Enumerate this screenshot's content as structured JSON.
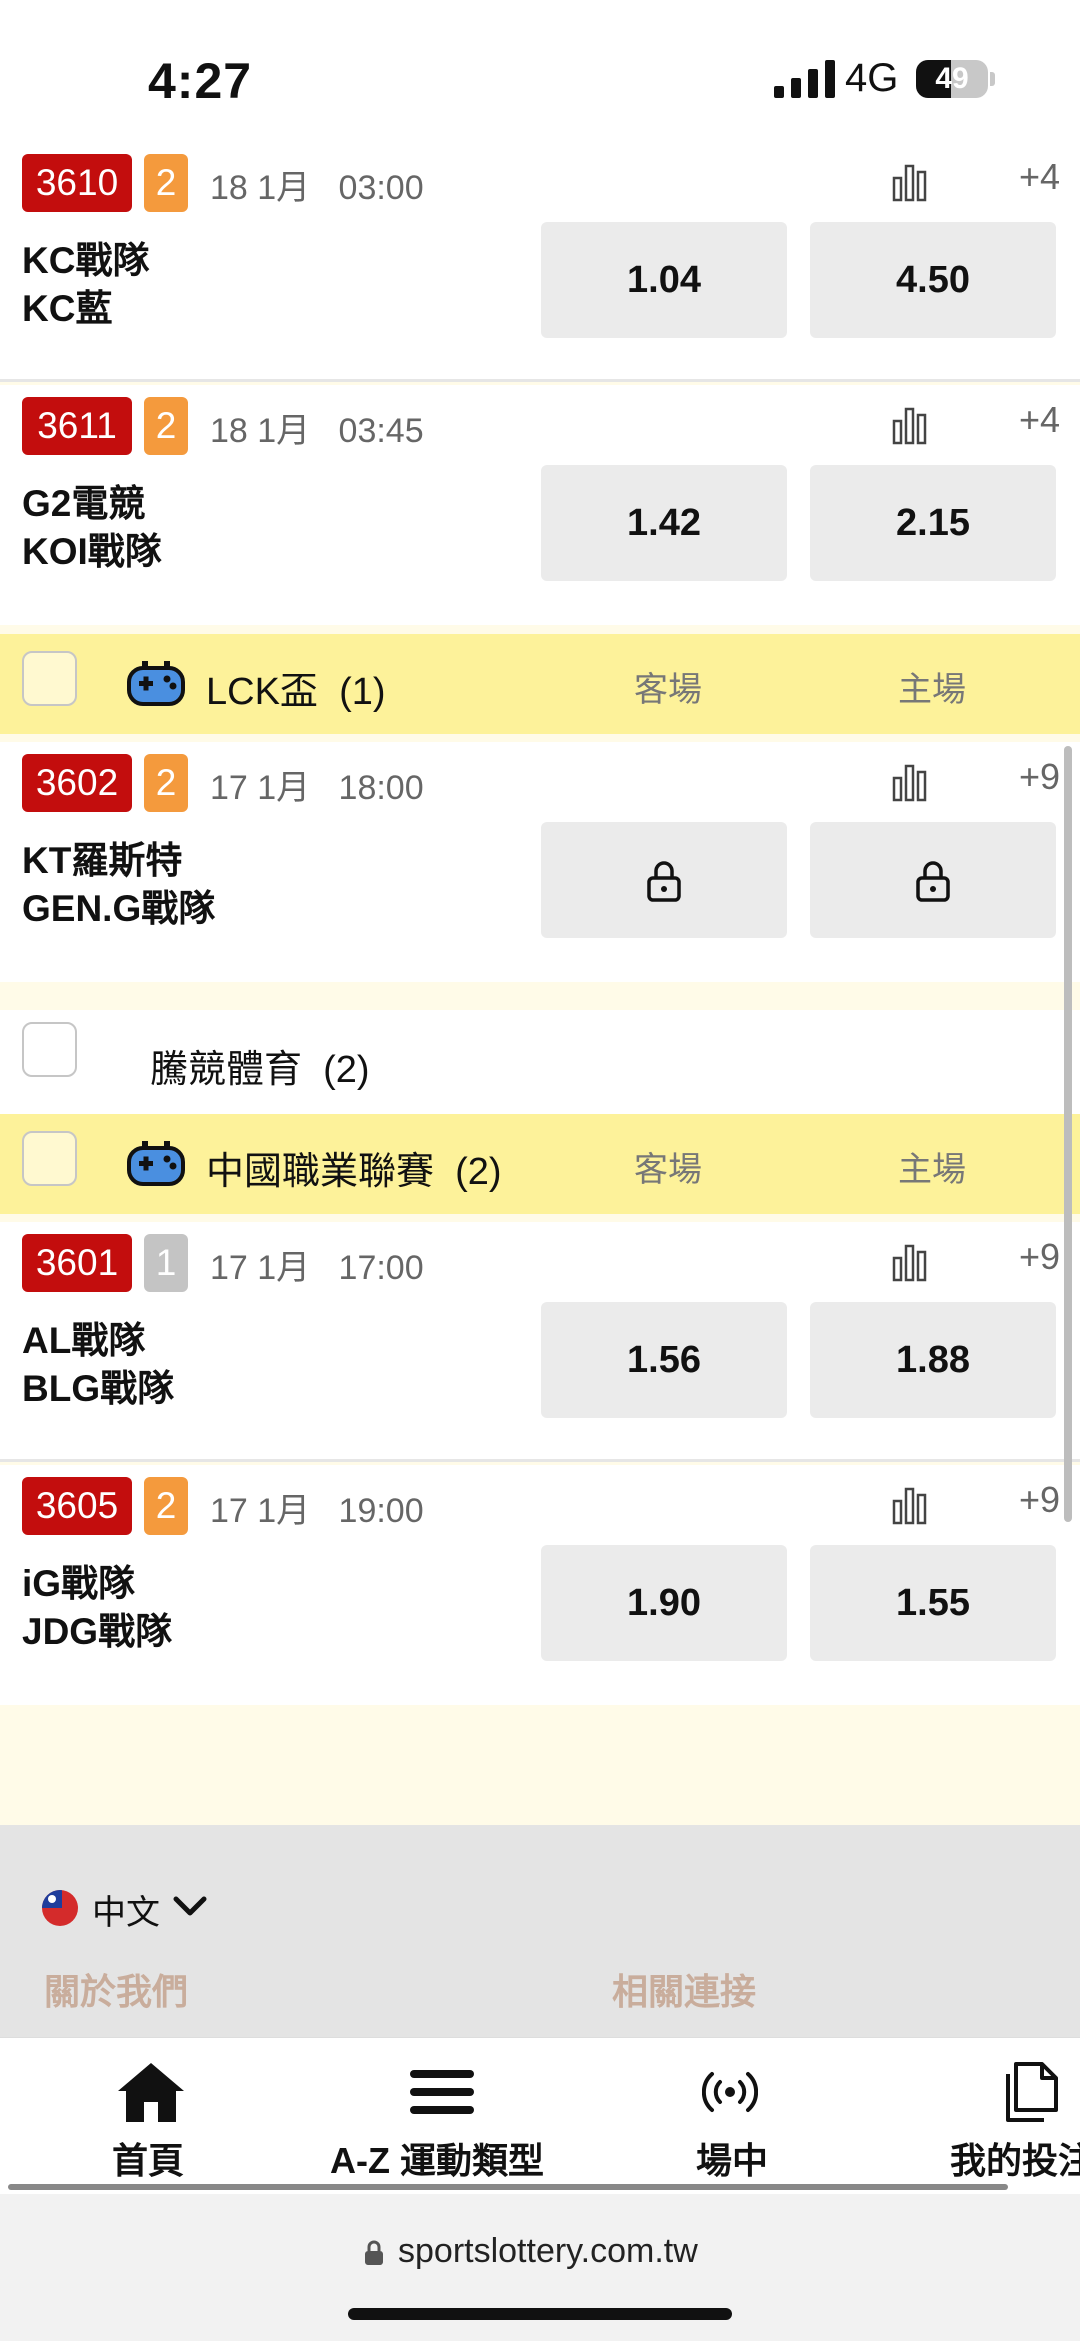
{
  "status_bar": {
    "time": "4:27",
    "network": "4G",
    "battery": "49",
    "battery_level": 0.49
  },
  "matches": [
    {
      "id": "3610",
      "num": "2",
      "date": "18 1月",
      "time": "03:00",
      "more": "+4",
      "team1": "KC戰隊",
      "team2": "KC藍",
      "odd1": "1.04",
      "odd2": "4.50",
      "locked": false
    },
    {
      "id": "3611",
      "num": "2",
      "date": "18 1月",
      "time": "03:45",
      "more": "+4",
      "team1": "G2電競",
      "team2": "KOI戰隊",
      "odd1": "1.42",
      "odd2": "2.15",
      "locked": false
    },
    {
      "id": "3602",
      "num": "2",
      "date": "17 1月",
      "time": "18:00",
      "more": "+9",
      "team1": "KT羅斯特",
      "team2": "GEN.G戰隊",
      "odd1": "",
      "odd2": "",
      "locked": true
    },
    {
      "id": "3601",
      "num": "1",
      "date": "17 1月",
      "time": "17:00",
      "more": "+9",
      "team1": "AL戰隊",
      "team2": "BLG戰隊",
      "odd1": "1.56",
      "odd2": "1.88",
      "locked": false
    },
    {
      "id": "3605",
      "num": "2",
      "date": "17 1月",
      "time": "19:00",
      "more": "+9",
      "team1": "iG戰隊",
      "team2": "JDG戰隊",
      "odd1": "1.90",
      "odd2": "1.55",
      "locked": false
    }
  ],
  "leagues": [
    {
      "name": "LCK盃",
      "count": "(1)",
      "away": "客場",
      "home": "主場"
    },
    {
      "name": "中國職業聯賽",
      "count": "(2)",
      "away": "客場",
      "home": "主場"
    }
  ],
  "sport_group": {
    "name": "騰競體育",
    "count": "(2)"
  },
  "footer": {
    "language": "中文",
    "about": "關於我們",
    "links": "相關連接"
  },
  "tabs": [
    {
      "label": "首頁",
      "icon": "home-icon"
    },
    {
      "label": "A-Z 運動類型",
      "icon": "menu-icon"
    },
    {
      "label": "場中",
      "icon": "live-icon"
    },
    {
      "label": "我的投注",
      "icon": "copy-icon"
    }
  ],
  "browser": {
    "url": "sportslottery.com.tw"
  },
  "colors": {
    "id_badge": "#c30d0d",
    "num_badge": "#f49a3d",
    "league_bar": "#fdf29a",
    "footer_link": "#c9ad9c"
  }
}
